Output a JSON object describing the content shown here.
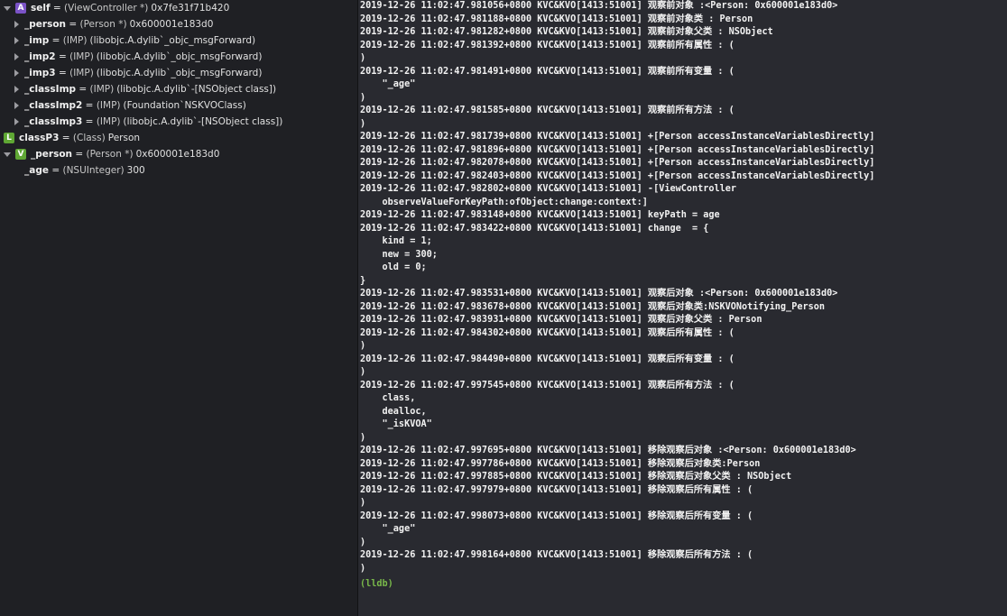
{
  "variables": [
    {
      "badge": "A",
      "expand": "open",
      "name": "self",
      "type": "(ViewController *)",
      "value": "0x7fe31f71b420",
      "indent": 0
    },
    {
      "badge": "",
      "expand": "closed",
      "name": "_person",
      "type": "(Person *)",
      "value": "0x600001e183d0",
      "indent": 1
    },
    {
      "badge": "",
      "expand": "closed",
      "name": "_imp",
      "type": "(IMP)",
      "value": "(libobjc.A.dylib`_objc_msgForward)",
      "indent": 1
    },
    {
      "badge": "",
      "expand": "closed",
      "name": "_imp2",
      "type": "(IMP)",
      "value": "(libobjc.A.dylib`_objc_msgForward)",
      "indent": 1
    },
    {
      "badge": "",
      "expand": "closed",
      "name": "_imp3",
      "type": "(IMP)",
      "value": "(libobjc.A.dylib`_objc_msgForward)",
      "indent": 1
    },
    {
      "badge": "",
      "expand": "closed",
      "name": "_classImp",
      "type": "(IMP)",
      "value": "(libobjc.A.dylib`-[NSObject class])",
      "indent": 1
    },
    {
      "badge": "",
      "expand": "closed",
      "name": "_classImp2",
      "type": "(IMP)",
      "value": "(Foundation`NSKVOClass)",
      "indent": 1
    },
    {
      "badge": "",
      "expand": "closed",
      "name": "_classImp3",
      "type": "(IMP)",
      "value": "(libobjc.A.dylib`-[NSObject class])",
      "indent": 1
    },
    {
      "badge": "L",
      "expand": "none",
      "name": "classP3",
      "type": "(Class)",
      "value": "Person",
      "indent": 0
    },
    {
      "badge": "V",
      "expand": "open",
      "name": "_person",
      "type": "(Person *)",
      "value": "0x600001e183d0",
      "indent": 0
    },
    {
      "badge": "",
      "expand": "none",
      "name": "_age",
      "type": "(NSUInteger)",
      "value": "300",
      "indent": 1
    }
  ],
  "console_lines": [
    "2019-12-26 11:02:47.981056+0800 KVC&KVO[1413:51001] 观察前对象 :<Person: 0x600001e183d0>",
    "2019-12-26 11:02:47.981188+0800 KVC&KVO[1413:51001] 观察前对象类 : Person",
    "2019-12-26 11:02:47.981282+0800 KVC&KVO[1413:51001] 观察前对象父类 : NSObject",
    "2019-12-26 11:02:47.981392+0800 KVC&KVO[1413:51001] 观察前所有属性 : (",
    ")",
    "2019-12-26 11:02:47.981491+0800 KVC&KVO[1413:51001] 观察前所有变量 : (",
    "    \"_age\"",
    ")",
    "2019-12-26 11:02:47.981585+0800 KVC&KVO[1413:51001] 观察前所有方法 : (",
    ")",
    "2019-12-26 11:02:47.981739+0800 KVC&KVO[1413:51001] +[Person accessInstanceVariablesDirectly]",
    "2019-12-26 11:02:47.981896+0800 KVC&KVO[1413:51001] +[Person accessInstanceVariablesDirectly]",
    "2019-12-26 11:02:47.982078+0800 KVC&KVO[1413:51001] +[Person accessInstanceVariablesDirectly]",
    "2019-12-26 11:02:47.982403+0800 KVC&KVO[1413:51001] +[Person accessInstanceVariablesDirectly]",
    "2019-12-26 11:02:47.982802+0800 KVC&KVO[1413:51001] -[ViewController",
    "    observeValueForKeyPath:ofObject:change:context:]",
    "2019-12-26 11:02:47.983148+0800 KVC&KVO[1413:51001] keyPath = age",
    "2019-12-26 11:02:47.983422+0800 KVC&KVO[1413:51001] change  = {",
    "    kind = 1;",
    "    new = 300;",
    "    old = 0;",
    "}",
    "2019-12-26 11:02:47.983531+0800 KVC&KVO[1413:51001] 观察后对象 :<Person: 0x600001e183d0>",
    "2019-12-26 11:02:47.983678+0800 KVC&KVO[1413:51001] 观察后对象类:NSKVONotifying_Person",
    "2019-12-26 11:02:47.983931+0800 KVC&KVO[1413:51001] 观察后对象父类 : Person",
    "2019-12-26 11:02:47.984302+0800 KVC&KVO[1413:51001] 观察后所有属性 : (",
    ")",
    "2019-12-26 11:02:47.984490+0800 KVC&KVO[1413:51001] 观察后所有变量 : (",
    ")",
    "2019-12-26 11:02:47.997545+0800 KVC&KVO[1413:51001] 观察后所有方法 : (",
    "    class,",
    "    dealloc,",
    "    \"_isKVOA\"",
    ")",
    "2019-12-26 11:02:47.997695+0800 KVC&KVO[1413:51001] 移除观察后对象 :<Person: 0x600001e183d0>",
    "2019-12-26 11:02:47.997786+0800 KVC&KVO[1413:51001] 移除观察后对象类:Person",
    "2019-12-26 11:02:47.997885+0800 KVC&KVO[1413:51001] 移除观察后对象父类 : NSObject",
    "2019-12-26 11:02:47.997979+0800 KVC&KVO[1413:51001] 移除观察后所有属性 : (",
    ")",
    "2019-12-26 11:02:47.998073+0800 KVC&KVO[1413:51001] 移除观察后所有变量 : (",
    "    \"_age\"",
    ")",
    "2019-12-26 11:02:47.998164+0800 KVC&KVO[1413:51001] 移除观察后所有方法 : (",
    ")"
  ],
  "prompt": "(lldb)",
  "colors": {
    "prompt": "#79b94a",
    "badge_A": "#7b53c7",
    "badge_L": "#5fa734",
    "badge_V": "#5fa734"
  }
}
